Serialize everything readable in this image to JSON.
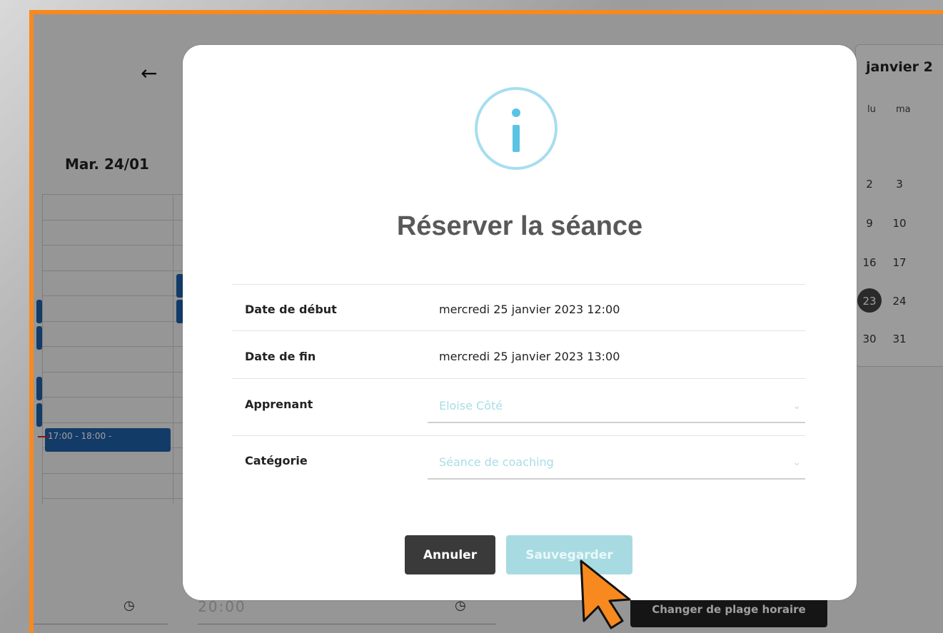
{
  "background": {
    "back_icon": "arrow-left-icon",
    "day_header": "Mar. 24/01",
    "events": [
      {
        "label": "17:00 - 18:00 -"
      }
    ],
    "mini_calendar": {
      "month": "janvier 2",
      "weekdays": [
        "lu",
        "ma"
      ],
      "rows": [
        [
          "2",
          "3"
        ],
        [
          "9",
          "10"
        ],
        [
          "16",
          "17"
        ],
        [
          "23",
          "24"
        ],
        [
          "30",
          "31"
        ]
      ],
      "today": "23"
    },
    "bottom": {
      "end_time": "20:00",
      "change_button": "Changer de plage horaire"
    }
  },
  "modal": {
    "icon": "info-icon",
    "title": "Réserver la séance",
    "fields": {
      "start_label": "Date de début",
      "start_value": "mercredi 25 janvier 2023 12:00",
      "end_label": "Date de fin",
      "end_value": "mercredi 25 janvier 2023 13:00",
      "learner_label": "Apprenant",
      "learner_value": "Eloise Côté",
      "category_label": "Catégorie",
      "category_value": "Séance de coaching"
    },
    "buttons": {
      "cancel": "Annuler",
      "save": "Sauvegarder"
    }
  },
  "colors": {
    "frame_border": "#f7891e",
    "accent": "#a8dbe1",
    "info_icon": "#5bc3e4",
    "event_blue": "#1f5fa8"
  }
}
